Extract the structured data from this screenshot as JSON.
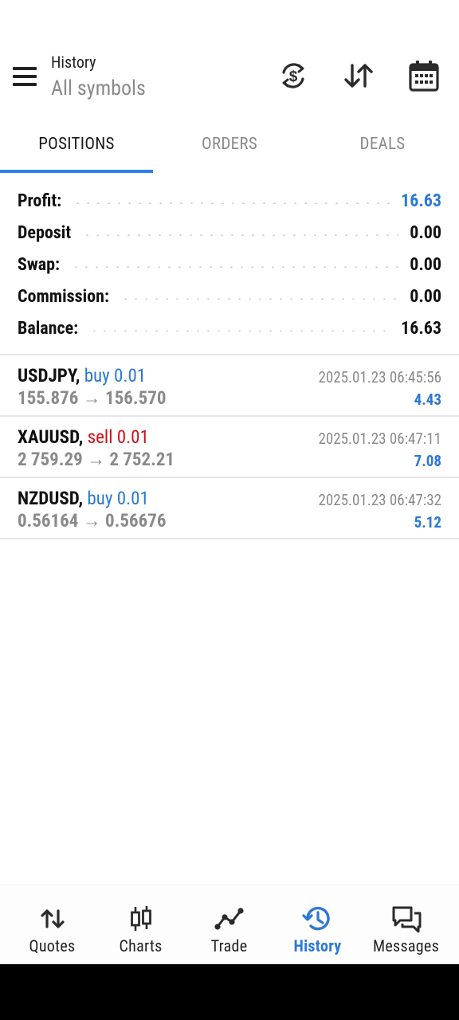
{
  "header": {
    "title": "History",
    "subtitle": "All symbols"
  },
  "tabs": [
    {
      "label": "POSITIONS",
      "active": true
    },
    {
      "label": "ORDERS",
      "active": false
    },
    {
      "label": "DEALS",
      "active": false
    }
  ],
  "summary": [
    {
      "label": "Profit:",
      "value": "16.63",
      "highlight": true
    },
    {
      "label": "Deposit",
      "value": "0.00",
      "highlight": false
    },
    {
      "label": "Swap:",
      "value": "0.00",
      "highlight": false
    },
    {
      "label": "Commission:",
      "value": "0.00",
      "highlight": false
    },
    {
      "label": "Balance:",
      "value": "16.63",
      "highlight": false
    }
  ],
  "positions": [
    {
      "symbol": "USDJPY,",
      "side": "buy 0.01",
      "side_type": "buy",
      "prices": "155.876 → 156.570",
      "time": "2025.01.23 06:45:56",
      "profit": "4.43"
    },
    {
      "symbol": "XAUUSD,",
      "side": "sell 0.01",
      "side_type": "sell",
      "prices": "2 759.29 → 2 752.21",
      "time": "2025.01.23 06:47:11",
      "profit": "7.08"
    },
    {
      "symbol": "NZDUSD,",
      "side": "buy 0.01",
      "side_type": "buy",
      "prices": "0.56164 → 0.56676",
      "time": "2025.01.23 06:47:32",
      "profit": "5.12"
    }
  ],
  "bottom_nav": [
    {
      "label": "Quotes",
      "icon": "quotes-arrows-icon",
      "active": false
    },
    {
      "label": "Charts",
      "icon": "candlestick-icon",
      "active": false
    },
    {
      "label": "Trade",
      "icon": "trade-line-icon",
      "active": false
    },
    {
      "label": "History",
      "icon": "history-clock-icon",
      "active": true
    },
    {
      "label": "Messages",
      "icon": "messages-icon",
      "active": false
    }
  ],
  "colors": {
    "accent": "#2a78d6",
    "sell": "#d0101a",
    "muted": "#8a8a8a"
  }
}
